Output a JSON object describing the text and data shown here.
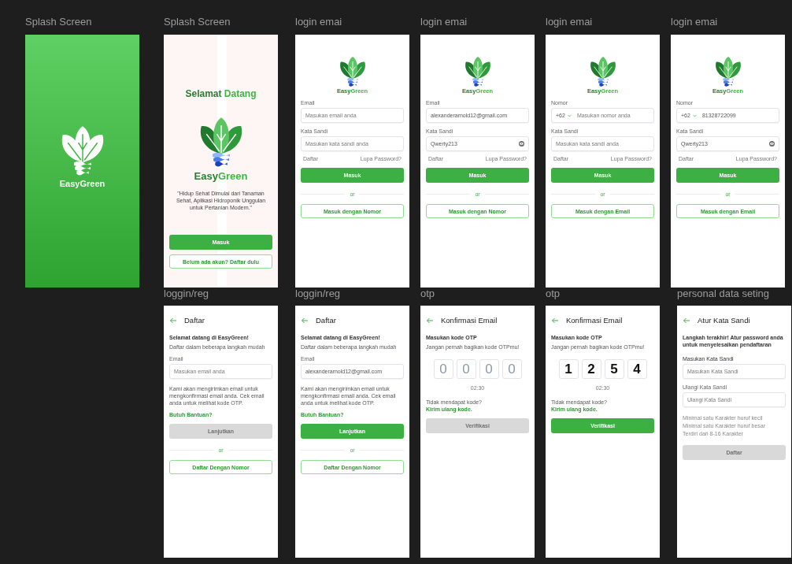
{
  "canvas": {
    "rows": [
      {
        "frames": [
          {
            "label": "Splash Screen",
            "kind": "splash",
            "body": [
              {
                "kind": "logo",
                "brand": [
                  "Easy",
                  "Green"
                ]
              }
            ]
          },
          {
            "label": "Splash Screen",
            "kind": "welcome",
            "body": [
              {
                "kind": "title",
                "parts": [
                  "Selamat",
                  "Datang"
                ]
              },
              {
                "kind": "logo",
                "brand": [
                  "Easy",
                  "Green"
                ]
              },
              {
                "kind": "quote",
                "text": "\"Hidup Sehat Dimulai dari Tanaman Sehat, Aplikasi Hidroponik Unggulan untuk Pertanian Modern.\""
              }
            ],
            "footer": [
              {
                "kind": "button",
                "disabled": false,
                "label": "Masuk"
              },
              {
                "kind": "outline_button",
                "label": "Belum ada akun? Daftar dulu"
              }
            ]
          },
          {
            "label": "login emai",
            "kind": "screen",
            "body": [
              {
                "kind": "logo",
                "brand": [
                  "Easy",
                  "Green"
                ]
              },
              {
                "kind": "label",
                "text": "Email"
              },
              {
                "kind": "field",
                "placeholder": "Masukan email anda"
              },
              {
                "kind": "label",
                "text": "Kata Sandi"
              },
              {
                "kind": "field",
                "placeholder": "Masukan kata sandi anda"
              },
              {
                "kind": "links",
                "left": "Daftar",
                "right": "Lupa Password?"
              },
              {
                "kind": "button",
                "disabled": false,
                "label": "Masuk"
              },
              {
                "kind": "divider",
                "text": "or"
              },
              {
                "kind": "outline_button",
                "label": "Masuk dengan Nomor"
              }
            ]
          },
          {
            "label": "login emai",
            "kind": "screen",
            "body": [
              {
                "kind": "logo",
                "brand": [
                  "Easy",
                  "Green"
                ]
              },
              {
                "kind": "label",
                "text": "Email"
              },
              {
                "kind": "field",
                "value": "alexanderarnold12@gmail.com"
              },
              {
                "kind": "label",
                "text": "Kata Sandi"
              },
              {
                "kind": "field",
                "value": "Qwerty213",
                "reveal_toggle": true
              },
              {
                "kind": "links",
                "left": "Daftar",
                "right": "Lupa Password?"
              },
              {
                "kind": "button",
                "disabled": false,
                "label": "Masuk"
              },
              {
                "kind": "divider",
                "text": "or"
              },
              {
                "kind": "outline_button",
                "label": "Masuk dengan Nomor"
              }
            ]
          },
          {
            "label": "login emai",
            "kind": "screen",
            "body": [
              {
                "kind": "logo",
                "brand": [
                  "Easy",
                  "Green"
                ]
              },
              {
                "kind": "label",
                "text": "Nomor"
              },
              {
                "kind": "field",
                "prefix": "+62",
                "placeholder": "Masukan nomor anda"
              },
              {
                "kind": "label",
                "text": "Kata Sandi"
              },
              {
                "kind": "field",
                "placeholder": "Masukan kata sandi anda"
              },
              {
                "kind": "links",
                "left": "Daftar",
                "right": "Lupa Password?"
              },
              {
                "kind": "button",
                "disabled": false,
                "label": "Masuk"
              },
              {
                "kind": "divider",
                "text": "or"
              },
              {
                "kind": "outline_button",
                "label": "Masuk dengan Email"
              }
            ]
          },
          {
            "label": "login emai",
            "kind": "screen",
            "body": [
              {
                "kind": "logo",
                "brand": [
                  "Easy",
                  "Green"
                ]
              },
              {
                "kind": "label",
                "text": "Nomor"
              },
              {
                "kind": "field",
                "prefix": "+62",
                "value": "81328722099"
              },
              {
                "kind": "label",
                "text": "Kata Sandi"
              },
              {
                "kind": "field",
                "value": "Qwerty213",
                "reveal_toggle": true
              },
              {
                "kind": "links",
                "left": "Daftar",
                "right": "Lupa Password?"
              },
              {
                "kind": "button",
                "disabled": false,
                "label": "Masuk"
              },
              {
                "kind": "divider",
                "text": "or"
              },
              {
                "kind": "outline_button",
                "label": "Masuk dengan Email"
              }
            ]
          }
        ]
      },
      {
        "frames": [
          {
            "label": "loggin/reg",
            "kind": "screen",
            "body": [
              {
                "kind": "appbar",
                "title": "Daftar"
              },
              {
                "kind": "subtitle",
                "text": "Selamat datang di EasyGreen!"
              },
              {
                "kind": "text",
                "text": "Daftar dalam beberapa langkah mudah"
              },
              {
                "kind": "label",
                "text": "Email"
              },
              {
                "kind": "field",
                "placeholder": "Masukan email anda"
              },
              {
                "kind": "text",
                "text": "Kami akan mengirimkan email untuk mengkonfirmasi email anda. Cek email anda untuk melihat kode OTP."
              },
              {
                "kind": "link",
                "text": "Butuh Bantuan?"
              },
              {
                "kind": "button",
                "disabled": true,
                "label": "Lanjutkan"
              },
              {
                "kind": "divider",
                "text": "or"
              },
              {
                "kind": "outline_button",
                "label": "Daftar Dengan Nomor"
              }
            ]
          },
          {
            "label": "loggin/reg",
            "kind": "screen",
            "body": [
              {
                "kind": "appbar",
                "title": "Daftar"
              },
              {
                "kind": "subtitle",
                "text": "Selamat datang di EasyGreen!"
              },
              {
                "kind": "text",
                "text": "Daftar dalam beberapa langkah mudah"
              },
              {
                "kind": "label",
                "text": "Email"
              },
              {
                "kind": "field",
                "value": "alexanderarnold12@gmail.com"
              },
              {
                "kind": "text",
                "text": "Kami akan mengirimkan email untuk mengkonfirmasi email anda. Cek email anda untuk melihat kode OTP."
              },
              {
                "kind": "link",
                "text": "Butuh Bantuan?"
              },
              {
                "kind": "button",
                "disabled": false,
                "label": "Lanjutkan"
              },
              {
                "kind": "divider",
                "text": "or"
              },
              {
                "kind": "outline_button",
                "label": "Daftar Dengan Nomor"
              }
            ]
          },
          {
            "label": "otp",
            "kind": "screen",
            "body": [
              {
                "kind": "appbar",
                "title": "Konfirmasi Email"
              },
              {
                "kind": "subtitle",
                "text": "Masukan kode OTP"
              },
              {
                "kind": "text",
                "text": "Jangan pernah bagikan kode OTPmu!"
              },
              {
                "kind": "otp",
                "digits": [
                  "0",
                  "0",
                  "0",
                  "0"
                ],
                "filled": false
              },
              {
                "kind": "timer",
                "text": "02:30"
              },
              {
                "kind": "text",
                "text": "Tidak mendapat kode?"
              },
              {
                "kind": "link",
                "text": "Kirim ulang kode."
              },
              {
                "kind": "button",
                "disabled": true,
                "label": "Verifikasi"
              }
            ]
          },
          {
            "label": "otp",
            "kind": "screen",
            "body": [
              {
                "kind": "appbar",
                "title": "Konfirmasi Email"
              },
              {
                "kind": "subtitle",
                "text": "Masukan kode OTP"
              },
              {
                "kind": "text",
                "text": "Jangan pernah bagikan kode OTPmu!"
              },
              {
                "kind": "otp",
                "digits": [
                  "1",
                  "2",
                  "5",
                  "4"
                ],
                "filled": true
              },
              {
                "kind": "timer",
                "text": "02:30"
              },
              {
                "kind": "text",
                "text": "Tidak mendapat kode?"
              },
              {
                "kind": "link",
                "text": "Kirim ulang kode."
              },
              {
                "kind": "button",
                "disabled": false,
                "label": "Verifikasi"
              }
            ]
          },
          {
            "label": "personal data seting",
            "kind": "screen",
            "body": [
              {
                "kind": "appbar",
                "title": "Atur Kata Sandi"
              },
              {
                "kind": "subtitle",
                "text": "Langkah terakhir! Atur password anda untuk menyelesaikan pendaftaran"
              },
              {
                "kind": "label",
                "text": "Masukan Kata Sandi"
              },
              {
                "kind": "field",
                "placeholder": "Masukan Kata Sandi"
              },
              {
                "kind": "label",
                "text": "Ulangi Kata Sandi"
              },
              {
                "kind": "field",
                "placeholder": "Ulangi Kata Sandi"
              },
              {
                "kind": "hint",
                "text": "Minimal satu Karakter huruf kecil"
              },
              {
                "kind": "hint",
                "text": "Minimal satu Karakter huruf besar"
              },
              {
                "kind": "hint",
                "text": "Terdiri dari 8-16 Karakter"
              },
              {
                "kind": "button",
                "disabled": true,
                "label": "Daftar"
              }
            ]
          }
        ]
      }
    ]
  }
}
